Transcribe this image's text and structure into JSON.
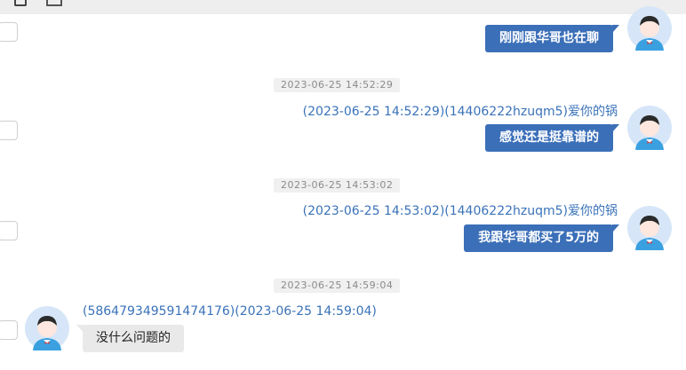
{
  "messages": [
    {
      "direction": "out",
      "text": "刚刚跟华哥也在聊"
    },
    {
      "direction": "out",
      "timestamp": "2023-06-25 14:52:29",
      "meta": "(2023-06-25 14:52:29)(14406222hzuqm5)爱你的锅",
      "text": "感觉还是挺靠谱的"
    },
    {
      "direction": "out",
      "timestamp": "2023-06-25 14:53:02",
      "meta": "(2023-06-25 14:53:02)(14406222hzuqm5)爱你的锅",
      "text": "我跟华哥都买了5万的"
    },
    {
      "direction": "in",
      "timestamp": "2023-06-25 14:59:04",
      "meta": "(586479349591474176)(2023-06-25 14:59:04)",
      "text": "没什么问题的"
    }
  ],
  "icons": {
    "toolbar": [
      "clipboard-icon",
      "tray-icon"
    ],
    "avatar": "user-avatar-icon",
    "select": "checkbox-icon"
  },
  "colors": {
    "out_bubble": "#3b6fb8",
    "in_bubble": "#e9e9e9",
    "meta_text": "#3a72b8",
    "timestamp_bg": "#f0f0f0",
    "avatar_bg": "#d6e6f8"
  }
}
